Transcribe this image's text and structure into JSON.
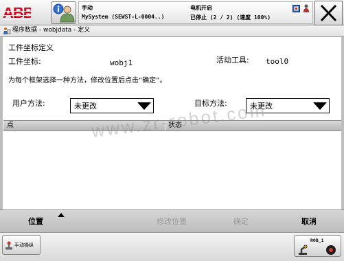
{
  "header": {
    "logo": "ABB",
    "mode": "手动",
    "system": "MySystem (SEWST-L-0004..)",
    "motor_status": "电机开启",
    "run_status": "已停止 (2 / 2) (速度 100%)",
    "icons": [
      "abb-logo",
      "user-info-icon",
      "io-window-icon",
      "user-lock-icon",
      "close-icon"
    ]
  },
  "breadcrumb": {
    "icon": "program-data-icon",
    "text": "程序数据 - wobjdata - 定义"
  },
  "main": {
    "title": "工件坐标定义",
    "wobj_label": "工件坐标:",
    "wobj_value": "wobj1",
    "tool_label": "活动工具:",
    "tool_value": "tool0",
    "instruction": "为每个框架选择一种方法，修改位置后点击“确定”。",
    "user_method": {
      "label": "用户方法:",
      "value": "未更改"
    },
    "target_method": {
      "label": "目标方法:",
      "value": "未更改"
    },
    "table": {
      "columns": [
        "点",
        "状态"
      ],
      "rows": []
    }
  },
  "watermark": "www.zr-robot.com",
  "actions": {
    "position_label": "位置",
    "position_enabled": true,
    "modify_position_label": "修改位置",
    "modify_position_enabled": false,
    "ok_label": "确定",
    "ok_enabled": false,
    "cancel_label": "取消",
    "cancel_enabled": true
  },
  "taskbar": {
    "jog_label": "手动操纵",
    "jog_icon": "jog-icon",
    "quickset_unit": "ROB_1",
    "quickset_icons": [
      "robot-unit-icon",
      "speed-icon"
    ]
  },
  "colors": {
    "logo_red": "#e2001a",
    "info_blue": "#2f6fd0",
    "disabled_text": "#9b9b9b",
    "table_header": "#c4c4c4",
    "action_bar": "#c9c9c9"
  }
}
